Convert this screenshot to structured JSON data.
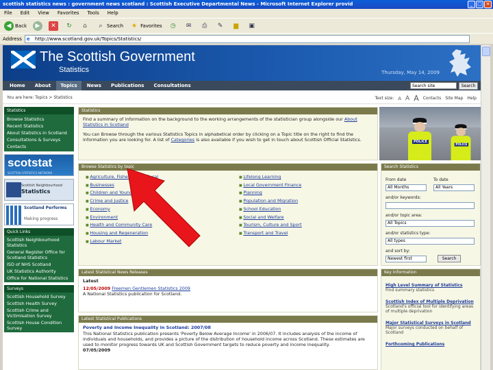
{
  "window": {
    "title": "scottish statistics news : government news scotland : Scottish Executive Departmental News - Microsoft Internet Explorer provid"
  },
  "menu": [
    "File",
    "Edit",
    "View",
    "Favorites",
    "Tools",
    "Help"
  ],
  "toolbar": {
    "back": "Back",
    "search": "Search",
    "favorites": "Favorites"
  },
  "address": {
    "label": "Address",
    "url": "http://www.scotland.gov.uk/Topics/Statistics/"
  },
  "header": {
    "title": "The Scottish Government",
    "subtitle": "Statistics",
    "date": "Thursday, May 14, 2009"
  },
  "nav": [
    "Home",
    "About",
    "Topics",
    "News",
    "Publications",
    "Consultations"
  ],
  "top_search": {
    "value": "Search site",
    "button": "Search"
  },
  "breadcrumb": "You are here:  Topics > Statistics",
  "utilities": {
    "text_size": "Text size:",
    "a1": "A",
    "a2": "A",
    "a3": "A",
    "contacts": "Contacts",
    "site_map": "Site Map",
    "help": "Help"
  },
  "sidebar": {
    "header": "Statistics",
    "links": [
      "Browse Statistics",
      "Recent Statistics",
      "About Statistics in Scotland",
      "Consultations & Surveys",
      "Contacts"
    ],
    "scotstat_logo": "scotstat",
    "scotstat_sub": "SCOTTISH STATISTICS NETWORK",
    "neigh_line1": "Scottish Neighbourhood",
    "neigh_line2": "Statistics",
    "perf_text": "Scotland Performs",
    "perf_sub": "Making progress",
    "quick_header": "Quick Links",
    "quick_links": [
      "Scottish Neighbourhood Statistics",
      "General Register Office for Scotland Statistics",
      "ISD of NHS Scotland",
      "UK Statistics Authority",
      "Office for National Statistics"
    ],
    "surveys_header": "Surveys",
    "surveys": [
      "Scottish Household Survey",
      "Scottish Health Survey",
      "Scottish Crime and Victimisation Survey",
      "Scottish House Condition Survey"
    ]
  },
  "main": {
    "header": "Statistics",
    "p1": "Find a summary of information on the background to the working arrangements of the statistician group alongside our",
    "p1_link": "About Statistics in Scotland",
    "p2_a": "You can Browse through the various Statistics Topics in alphabetical order by clicking on a Topic title on the right to find the information you are looking for. A list of",
    "p2_link": "Categories",
    "p2_b": "is also available if you wish to get in touch about Scottish Official Statistics."
  },
  "browse": {
    "header": "Browse Statistics by topic",
    "col1": [
      "Agriculture, Fisheries and Rural",
      "Businesses",
      "Children and Young People",
      "Crime and Justice",
      "Economy",
      "Environment",
      "Health and Community Care",
      "Housing and Regeneration",
      "Labour Market"
    ],
    "col2": [
      "Lifelong Learning",
      "Local Government Finance",
      "Planning",
      "Population and Migration",
      "School Education",
      "Social and Welfare",
      "Tourism, Culture and Sport",
      "Transport and Travel"
    ]
  },
  "search_stats": {
    "header": "Search Statistics",
    "from_label": "From date",
    "to_label": "To date",
    "from_value": "All Months",
    "to_value": "All Years",
    "keywords_label": "and/or keywords:",
    "topic_label": "and/or topic area:",
    "topic_value": "All Topics",
    "type_label": "and/or statistics type:",
    "type_value": "All types",
    "sort_label": "and sort by:",
    "sort_value": "Newest first",
    "button": "Search"
  },
  "latest": {
    "header": "Latest Statistical News Releases",
    "latest_label": "Latest",
    "date": "12/05/2009",
    "link": "Freemen Gentlemen Statistics 2009",
    "desc": "A National Statistics publication for Scotland."
  },
  "pubs": {
    "header": "Latest Statistical Publications",
    "title": "Poverty and Income Inequality in Scotland: 2007/08",
    "desc": "This National Statistics publication presents 'Poverty Below Average Income' in 2006/07. It includes analysis of the income of individuals and households, and provides a picture of the distribution of household income across Scotland. These estimates are used to monitor progress towards UK and Scottish Government targets to reduce poverty and income inequality.",
    "date": "07/05/2009"
  },
  "key_info": {
    "header": "Key Information",
    "items": [
      {
        "title": "High Level Summary of Statistics",
        "desc": "Find summary statistics"
      },
      {
        "title": "Scottish Index of Multiple Deprivation",
        "desc": "Scotland's official tool for identifying areas of multiple deprivation"
      },
      {
        "title": "Major Statistical Surveys in Scotland",
        "desc": "Major surveys conducted on behalf of Scotland"
      },
      {
        "title": "Forthcoming Publications",
        "desc": ""
      }
    ]
  },
  "colors": {
    "brand_blue": "#0d3e88",
    "sidebar_green": "#1f6b3d",
    "arrow_red": "#e8161b"
  }
}
